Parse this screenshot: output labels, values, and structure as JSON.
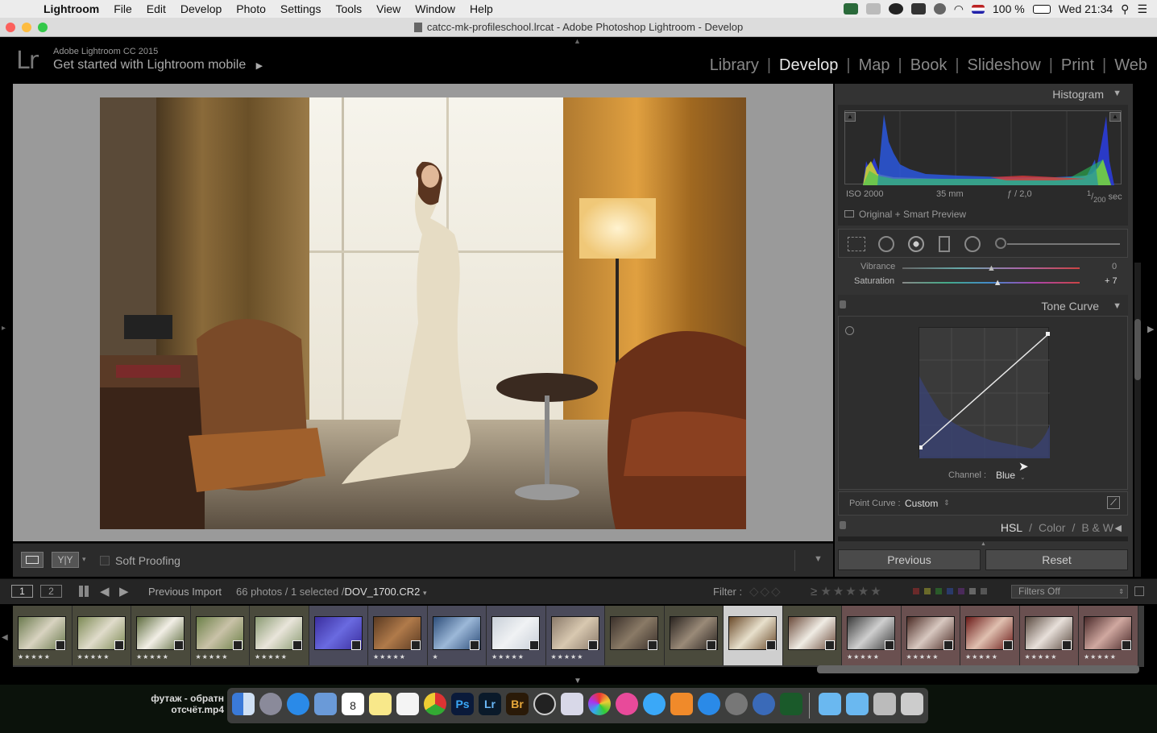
{
  "menubar": {
    "app_name": "Lightroom",
    "items": [
      "File",
      "Edit",
      "Develop",
      "Photo",
      "Settings",
      "Tools",
      "View",
      "Window",
      "Help"
    ],
    "battery": "100 %",
    "clock": "Wed 21:34"
  },
  "window": {
    "title": "catcc-mk-profileschool.lrcat - Adobe Photoshop Lightroom - Develop"
  },
  "header": {
    "logo": "Lr",
    "version": "Adobe Lightroom CC 2015",
    "mobile_prompt": "Get started with Lightroom mobile",
    "modules": [
      "Library",
      "Develop",
      "Map",
      "Book",
      "Slideshow",
      "Print",
      "Web"
    ],
    "active_module": "Develop"
  },
  "toolbar": {
    "soft_proofing": "Soft Proofing"
  },
  "histogram": {
    "title": "Histogram",
    "iso": "ISO 2000",
    "focal": "35 mm",
    "aperture": "ƒ / 2,0",
    "shutter_num": "1",
    "shutter_den": "200",
    "shutter_unit": "sec",
    "preview": "Original + Smart Preview"
  },
  "basic": {
    "vibrance_label": "Vibrance",
    "vibrance_value": "0",
    "vibrance_level": 0.5,
    "saturation_label": "Saturation",
    "saturation_value": "+ 7",
    "saturation_level": 0.535
  },
  "tone_curve": {
    "title": "Tone Curve",
    "channel_label": "Channel :",
    "channel_value": "Blue",
    "point_curve_label": "Point Curve :",
    "point_curve_value": "Custom"
  },
  "hsl_tabs": [
    "HSL",
    "Color",
    "B & W"
  ],
  "buttons": {
    "previous": "Previous",
    "reset": "Reset"
  },
  "filmbar": {
    "page1": "1",
    "page2": "2",
    "source": "Previous Import",
    "count": "66 photos / 1 selected /",
    "filename": "DOV_1700.CR2",
    "filter_label": "Filter :",
    "filters_off": "Filters Off"
  },
  "filmstrip": [
    {
      "stars": "★★★★★",
      "c1": "#6b7a4e",
      "c2": "#d8d3c0"
    },
    {
      "stars": "★★★★★",
      "c1": "#7d8a55",
      "c2": "#e0dccb"
    },
    {
      "stars": "★★★★★",
      "c1": "#5d6b3e",
      "c2": "#f2efe6"
    },
    {
      "stars": "★★★★★",
      "c1": "#6c8048",
      "c2": "#c9c2a8"
    },
    {
      "stars": "★★★★★",
      "c1": "#8a9a72",
      "c2": "#e9e5da"
    },
    {
      "stars": "",
      "c1": "#3a2e9e",
      "c2": "#6a6ae0"
    },
    {
      "stars": "★★★★★",
      "c1": "#5a3a22",
      "c2": "#b07a4a"
    },
    {
      "stars": "★",
      "c1": "#2e4e7a",
      "c2": "#9cb8d8"
    },
    {
      "stars": "★★★★★",
      "c1": "#c8cfd8",
      "c2": "#f0f2f4"
    },
    {
      "stars": "★★★★★",
      "c1": "#8a7a6a",
      "c2": "#d8c8b0"
    },
    {
      "stars": "",
      "c1": "#3a302a",
      "c2": "#8a7a66"
    },
    {
      "stars": "",
      "c1": "#2a2420",
      "c2": "#9a8a78"
    },
    {
      "stars": "",
      "c1": "#6a4a2a",
      "c2": "#e8e0cc"
    },
    {
      "stars": "",
      "c1": "#6a4a3a",
      "c2": "#f0ece4"
    },
    {
      "stars": "★★★★★",
      "c1": "#3a3a3a",
      "c2": "#cfcfcf"
    },
    {
      "stars": "★★★★★",
      "c1": "#4a2a24",
      "c2": "#d8c8c0"
    },
    {
      "stars": "★★★★★",
      "c1": "#6a1a18",
      "c2": "#e0c0b0"
    },
    {
      "stars": "★★★★★",
      "c1": "#5a4a40",
      "c2": "#e8e0da"
    },
    {
      "stars": "★★★★★",
      "c1": "#4a2a2a",
      "c2": "#d0a8a0"
    }
  ],
  "dock": {
    "file_label_line1": "футаж - обратн",
    "file_label_line2": "отсчёт.mp4",
    "calendar_day": "8"
  }
}
